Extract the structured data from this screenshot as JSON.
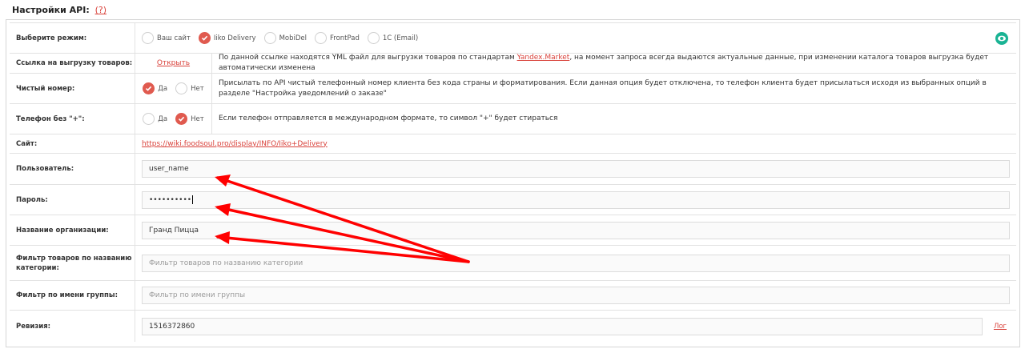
{
  "header": {
    "title": "Настройки API:",
    "help": "(?)"
  },
  "mode": {
    "label": "Выберите режим:",
    "options": [
      {
        "label": "Ваш сайт",
        "selected": false
      },
      {
        "label": "Iiko Delivery",
        "selected": true
      },
      {
        "label": "MobiDel",
        "selected": false
      },
      {
        "label": "FrontPad",
        "selected": false
      },
      {
        "label": "1С (Email)",
        "selected": false
      }
    ]
  },
  "export_link": {
    "label": "Ссылка на выгрузку товаров:",
    "action": "Открыть",
    "desc_before": "По данной ссылке находятся YML файл для выгрузки товаров по стандартам ",
    "desc_link": "Yandex.Market",
    "desc_after": ", на момент запроса всегда выдаются актуальные данные, при изменении каталога товаров выгрузка будет автоматически изменена"
  },
  "clean_number": {
    "label": "Чистый номер:",
    "yes": "Да",
    "no": "Нет",
    "value": "yes",
    "desc": "Присылать по API чистый телефонный номер клиента без кода страны и форматирования. Если данная опция будет отключена, то телефон клиента будет присылаться исходя из выбранных опций в разделе \"Настройка уведомлений о заказе\""
  },
  "phone_plus": {
    "label": "Телефон без \"+\":",
    "yes": "Да",
    "no": "Нет",
    "value": "no",
    "desc": "Если телефон отправляется в международном формате, то символ \"+\" будет стираться"
  },
  "site": {
    "label": "Сайт:",
    "url": "https://wiki.foodsoul.pro/display/INFO/Iiko+Delivery"
  },
  "users": {
    "label": "Пользователь:",
    "value": "user_name"
  },
  "password": {
    "label": "Пароль:",
    "value": "••••••••••"
  },
  "org": {
    "label": "Название организации:",
    "value": "Гранд Пицца"
  },
  "category_filter": {
    "label": "Фильтр товаров по названию категории:",
    "placeholder": "Фильтр товаров по названию категории"
  },
  "group_filter": {
    "label": "Фильтр по имени группы:",
    "placeholder": "Фильтр по имени группы"
  },
  "revision": {
    "label": "Ревизия:",
    "value": "1516372860",
    "log": "Лог"
  },
  "colors": {
    "accent": "#e05a4f",
    "link": "#d9423b",
    "eye": "#1ab394",
    "arrow": "#ff0000"
  }
}
